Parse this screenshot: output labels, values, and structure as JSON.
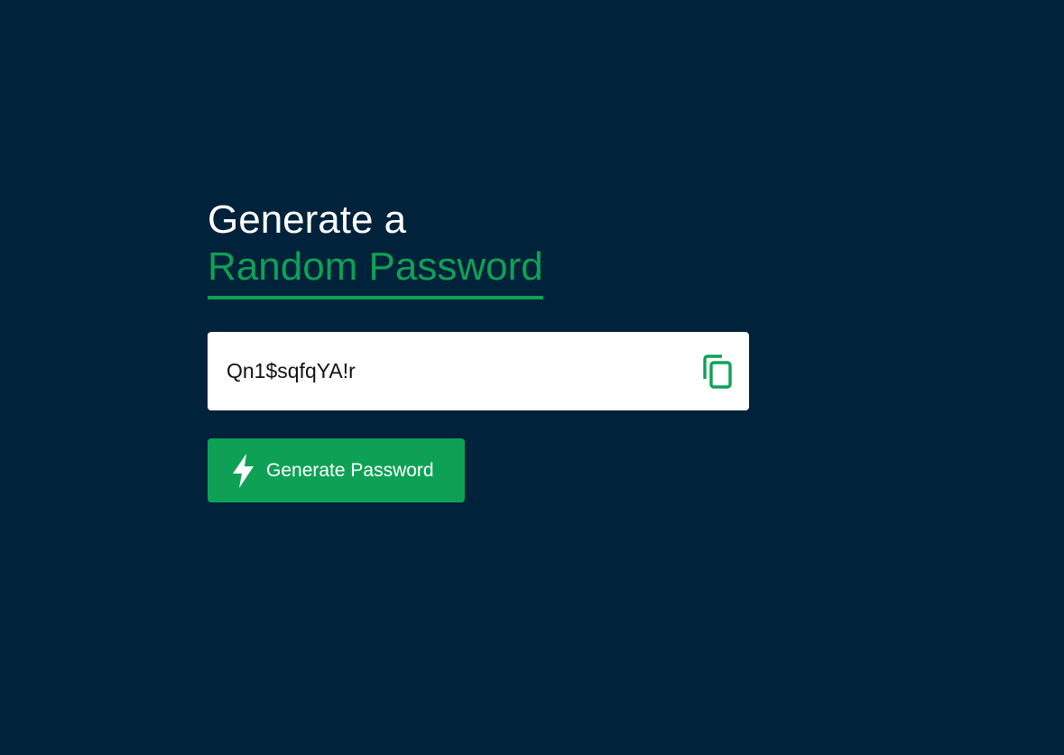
{
  "heading": {
    "line1": "Generate a",
    "line2": "Random Password"
  },
  "password": {
    "value": "Qn1$sqfqYA!r",
    "copy_icon": "copy-icon"
  },
  "generate_button": {
    "label": "Generate Password",
    "icon": "lightning-bolt-icon"
  },
  "colors": {
    "background": "#00223a",
    "accent": "#0ea156",
    "text_light": "#ffffff"
  }
}
